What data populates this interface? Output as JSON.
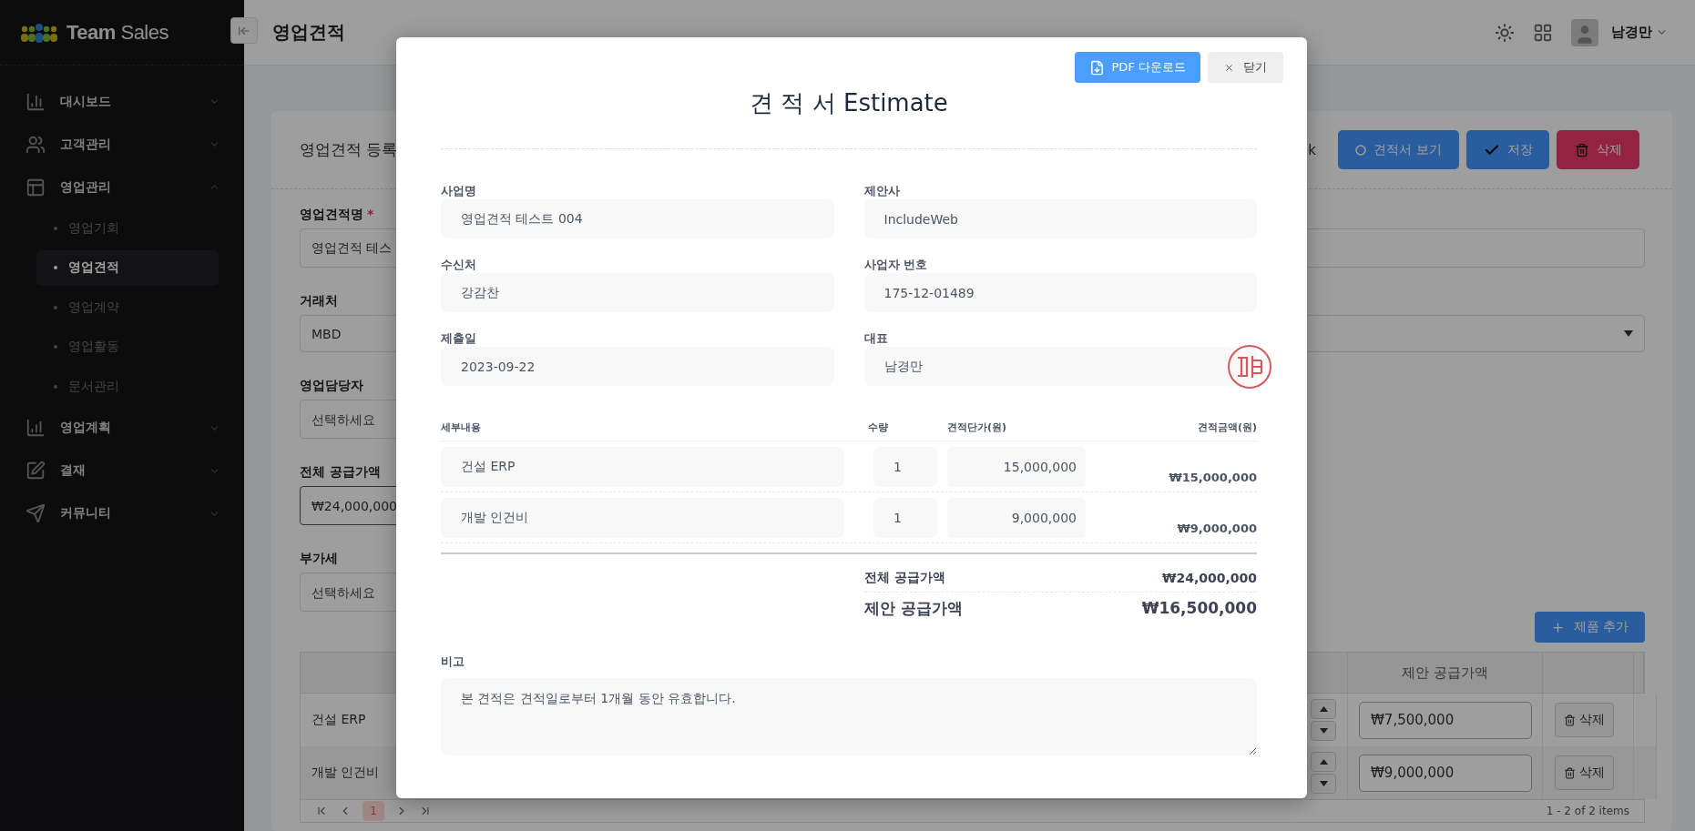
{
  "sidebar": {
    "brand": "**Team** Sales",
    "items": [
      {
        "label": "대시보드",
        "expanded": false
      },
      {
        "label": "고객관리",
        "expanded": false
      },
      {
        "label": "영업관리",
        "expanded": true,
        "children": [
          {
            "label": "영업기회",
            "selected": false
          },
          {
            "label": "영업견적",
            "selected": true
          },
          {
            "label": "영업계약",
            "selected": false
          },
          {
            "label": "영업활동",
            "selected": false
          },
          {
            "label": "문서관리",
            "selected": false
          }
        ]
      },
      {
        "label": "영업계획",
        "expanded": false
      },
      {
        "label": "결재",
        "expanded": false
      },
      {
        "label": "커뮤니티",
        "expanded": false
      }
    ]
  },
  "header": {
    "title": "영업견적",
    "user": "남경만"
  },
  "card": {
    "title": "영업견적 등록",
    "back_link": "k",
    "buttons": [
      {
        "label": "견적서 보기",
        "kind": "view"
      },
      {
        "label": "저장",
        "kind": "save"
      },
      {
        "label": "삭제",
        "kind": "delete"
      }
    ],
    "fields": [
      {
        "label": "영업견적명",
        "required_mark": "*",
        "kind": "text",
        "wide": true,
        "focused": false,
        "value": "영업견적 테스"
      },
      {
        "label": "거래처",
        "kind": "select",
        "wide": true,
        "value": "MBD"
      },
      {
        "label": "영업담당자",
        "kind": "text",
        "wide": false,
        "focused": false,
        "placeholder": "선택하세요"
      },
      {
        "label": "전체 공급가액",
        "kind": "text",
        "wide": false,
        "focused": true,
        "value": "₩24,000,000"
      },
      {
        "label": "부가세",
        "kind": "text",
        "wide": false,
        "focused": false,
        "placeholder": "선택하세요"
      }
    ],
    "add_button": "제품 추가",
    "table": {
      "columns": [
        "제안 공급가액"
      ],
      "rows": [
        {
          "product": "건설 ERP",
          "proposal": "₩7,500,000",
          "delete": "삭제"
        },
        {
          "product": "개발 인건비",
          "proposal": "₩9,000,000",
          "delete": "삭제"
        }
      ]
    },
    "pagination": {
      "pages": [
        {
          "label": "1",
          "selected": true
        }
      ],
      "summary": "1 - 2 of 2 items"
    }
  },
  "modal": {
    "pdf_button": "PDF 다운로드",
    "close_button": "닫기",
    "title": "견 적 서 Estimate",
    "fields": [
      {
        "label": "사업명",
        "value": "영업견적 테스트 004"
      },
      {
        "label": "제안사",
        "value": "IncludeWeb"
      },
      {
        "label": "수신처",
        "value": "강감찬"
      },
      {
        "label": "사업자 번호",
        "value": "175-12-01489"
      },
      {
        "label": "제출일",
        "value": "2023-09-22"
      },
      {
        "label": "대표",
        "value": "남경만"
      }
    ],
    "items": {
      "columns": [
        "세부내용",
        "수량",
        "견적단가(원)",
        "견적금액(원)"
      ],
      "rows": [
        {
          "description": "건설 ERP",
          "quantity": "1",
          "unit_price": "15,000,000",
          "amount": "₩15,000,000"
        },
        {
          "description": "개발 인건비",
          "quantity": "1",
          "unit_price": "9,000,000",
          "amount": "₩9,000,000"
        }
      ]
    },
    "totals": [
      {
        "label": "전체 공급가액",
        "value": "₩24,000,000",
        "kind": "subtotal"
      },
      {
        "label": "제안 공급가액",
        "value": "₩16,500,000",
        "kind": "total"
      }
    ],
    "remarks": {
      "label": "비고",
      "value": "본 견적은 견적일로부터 1개월 동안 유효합니다."
    }
  }
}
